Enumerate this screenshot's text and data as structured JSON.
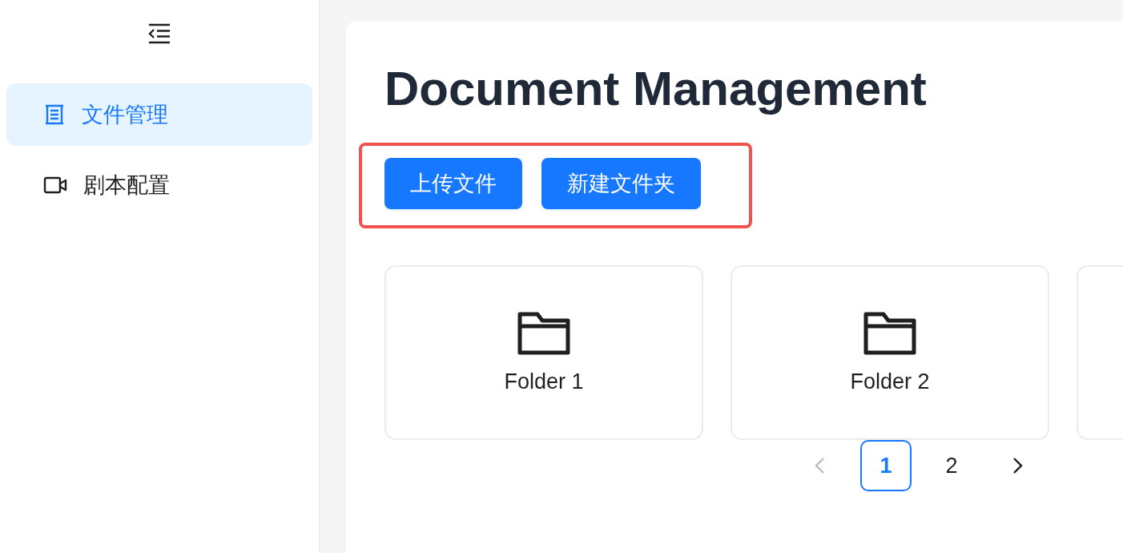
{
  "sidebar": {
    "items": [
      {
        "label": "文件管理",
        "selected": true,
        "kind": "files"
      },
      {
        "label": "剧本配置",
        "selected": false,
        "kind": "video"
      }
    ]
  },
  "page": {
    "title": "Document Management",
    "toolbar": {
      "highlighted": true,
      "buttons": [
        "上传文件",
        "新建文件夹"
      ]
    },
    "folders": [
      {
        "kind": "folder",
        "name": "Folder 1"
      },
      {
        "kind": "folder",
        "name": "Folder 2"
      },
      {
        "kind": "cut_off"
      }
    ],
    "pagination": {
      "prev_disabled": true,
      "next_disabled": false,
      "pages": [
        {
          "label": "1",
          "selected": true
        },
        {
          "label": "2",
          "selected": false
        }
      ]
    }
  }
}
